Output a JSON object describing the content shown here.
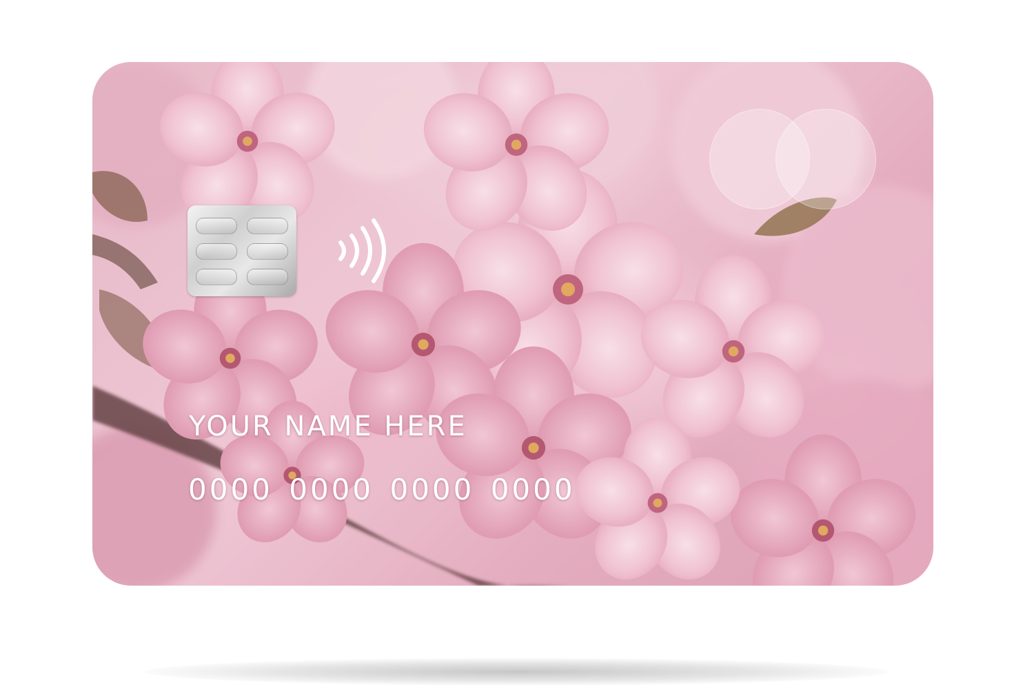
{
  "card": {
    "holder_name": "YOUR NAME HERE",
    "number": "0000 0000 0000 0000",
    "background_image": "pink-cherry-blossom-photo",
    "colors": {
      "text": "#ffffff",
      "blossom_light": "#f6d3df",
      "blossom_mid": "#e7b9c8",
      "blossom_dark": "#d89bb0",
      "branch": "#4a2a2c"
    },
    "icons": [
      "chip-icon",
      "contactless-icon",
      "brand-logo-circles"
    ]
  }
}
